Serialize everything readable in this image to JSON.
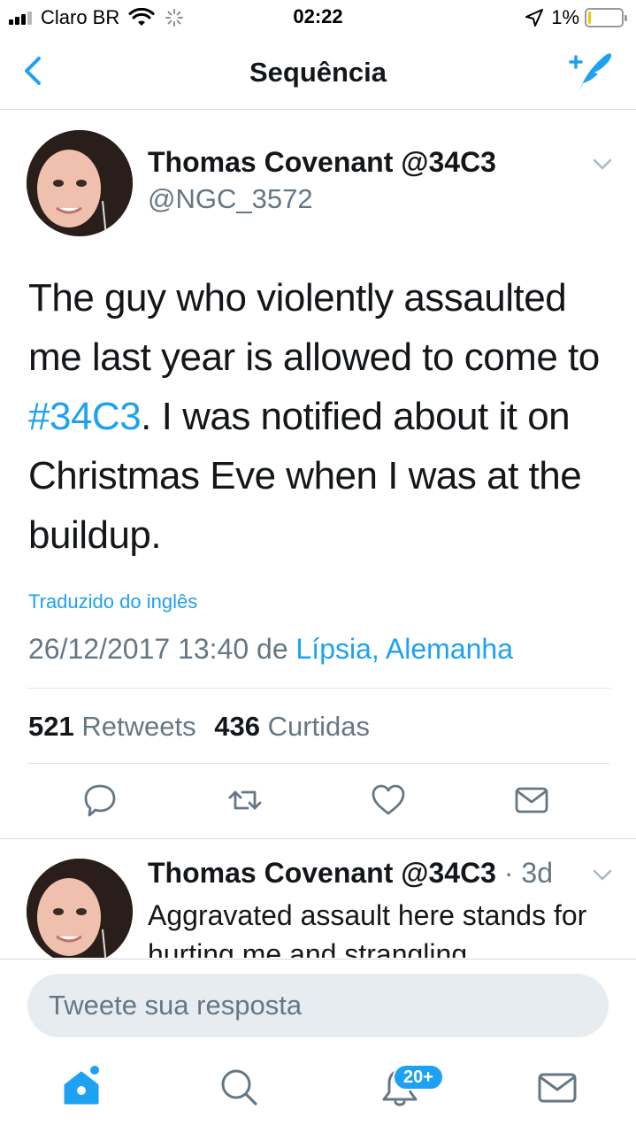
{
  "status_bar": {
    "carrier": "Claro BR",
    "time": "02:22",
    "battery_percent": "1%",
    "battery_level": 0.01
  },
  "nav": {
    "title": "Sequência",
    "back_icon": "chevron-left-icon",
    "compose_icon": "compose-tweet-icon"
  },
  "main_tweet": {
    "author_name": "Thomas Covenant @34C3",
    "author_handle": "@NGC_3572",
    "text_before_hashtag": "The guy who violently assaulted me last year is allowed to come to ",
    "hashtag": "#34C3",
    "text_after_hashtag": ". I was notified about it on Christmas Eve when I was at the buildup.",
    "translated_label": "Traduzido do inglês",
    "timestamp": "26/12/2017 13:40",
    "from_word": "de",
    "location": "Lípsia, Alemanha",
    "retweets_count": "521",
    "retweets_label": "Retweets",
    "likes_count": "436",
    "likes_label": "Curtidas"
  },
  "reply_tweet": {
    "author_name": "Thomas Covenant @34C3",
    "age": "· 3d",
    "text": "Aggravated assault here stands for hurting me and strangling"
  },
  "composer": {
    "placeholder": "Tweete sua resposta"
  },
  "tab_bar": {
    "notifications_badge": "20+"
  },
  "colors": {
    "accent": "#1da1f2",
    "text_primary": "#14171a",
    "text_secondary": "#657786",
    "divider": "#e1e8ed",
    "input_bg": "#e6ecf0"
  }
}
